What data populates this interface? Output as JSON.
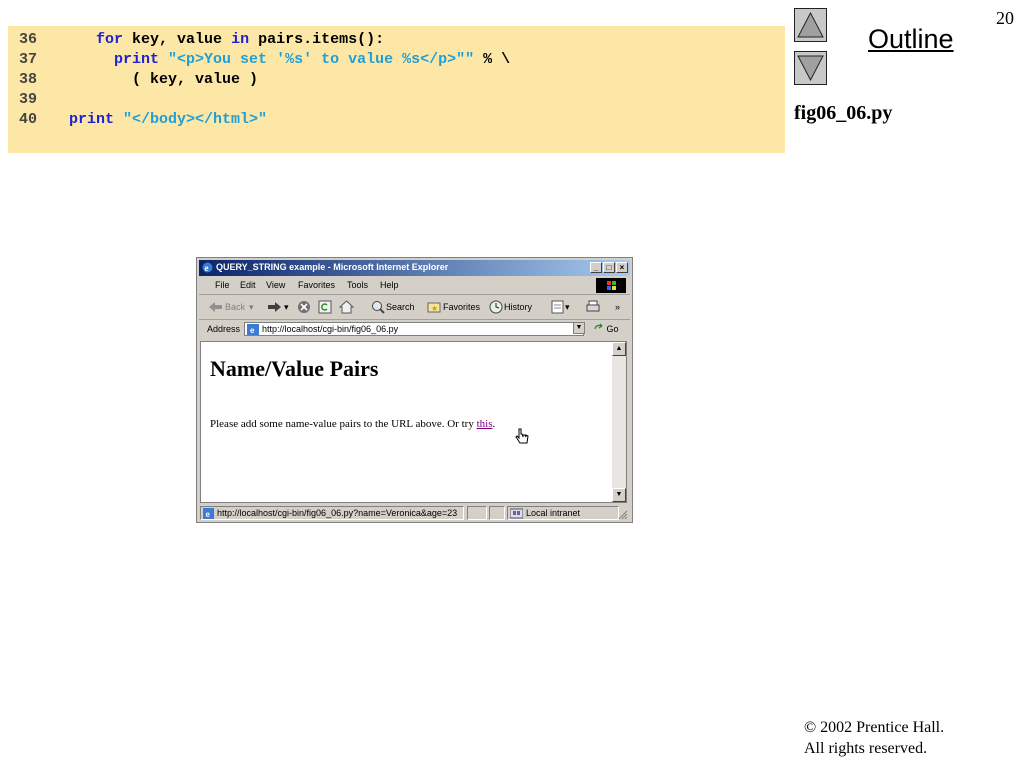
{
  "code": {
    "lines": [
      {
        "num": "36",
        "indent": "   ",
        "parts": [
          {
            "t": "for",
            "c": "kw"
          },
          {
            "t": " key, value ",
            "c": "plain"
          },
          {
            "t": "in",
            "c": "kw"
          },
          {
            "t": " pairs.items():",
            "c": "plain"
          }
        ]
      },
      {
        "num": "37",
        "indent": "     ",
        "parts": [
          {
            "t": "print",
            "c": "kw"
          },
          {
            "t": " ",
            "c": "plain"
          },
          {
            "t": "\"<p>You set '%s' to value %s</p>\"\"",
            "c": "str"
          },
          {
            "t": " % \\",
            "c": "plain"
          }
        ]
      },
      {
        "num": "38",
        "indent": "       ",
        "parts": [
          {
            "t": "( key, value )",
            "c": "plain"
          }
        ]
      },
      {
        "num": "39",
        "indent": "",
        "parts": []
      },
      {
        "num": "40",
        "indent": "",
        "parts": [
          {
            "t": "print",
            "c": "kw"
          },
          {
            "t": " ",
            "c": "plain"
          },
          {
            "t": "\"</body></html>\"",
            "c": "str"
          }
        ]
      }
    ]
  },
  "slide": {
    "number": "20",
    "outline_label": "Outline",
    "figure_label": "fig06_06.py",
    "copyright_line1": "© 2002 Prentice Hall.",
    "copyright_line2": "All rights reserved."
  },
  "browser": {
    "title": "QUERY_STRING example - Microsoft Internet Explorer",
    "window_buttons": {
      "minimize": "_",
      "maximize": "□",
      "close": "×"
    },
    "menu": [
      "File",
      "Edit",
      "View",
      "Favorites",
      "Tools",
      "Help"
    ],
    "toolbar": {
      "back": "Back",
      "search": "Search",
      "favorites": "Favorites",
      "history": "History",
      "more": "»"
    },
    "address_label": "Address",
    "address_value": "http://localhost/cgi-bin/fig06_06.py",
    "go_label": "Go",
    "page_heading": "Name/Value Pairs",
    "page_text": "Please add some name-value pairs to the URL above. Or try ",
    "page_link": "this",
    "page_text_end": ".",
    "status_url": "http://localhost/cgi-bin/fig06_06.py?name=Veronica&age=23",
    "status_zone": "Local intranet"
  },
  "colors": {
    "code_bg": "#fde7a6",
    "keyword": "#1f1fd6",
    "string": "#1f9fd6",
    "title_bar": "#0a246a"
  }
}
